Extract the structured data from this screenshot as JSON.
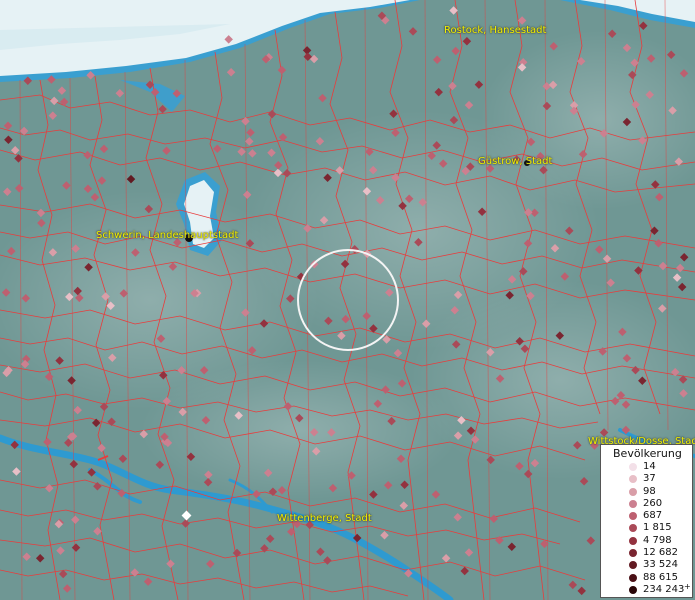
{
  "map": {
    "labels": [
      {
        "id": "rostock",
        "text": "Rostock, Hansestadt"
      },
      {
        "id": "guestrow",
        "text": "Güstrow, Stadt"
      },
      {
        "id": "schwerin",
        "text": "Schwerin, Landeshauptstadt"
      },
      {
        "id": "wittstock",
        "text": "Wittstock/Dosse, Stad"
      },
      {
        "id": "wittenberge",
        "text": "Wittenberge, Stadt"
      }
    ]
  },
  "legend": {
    "title": "Bevölkerung",
    "items": [
      {
        "label": "14",
        "color": "#f3e0e8"
      },
      {
        "label": "37",
        "color": "#e8bfc7"
      },
      {
        "label": "98",
        "color": "#d99ea8"
      },
      {
        "label": "260",
        "color": "#cc8090"
      },
      {
        "label": "687",
        "color": "#bd6070"
      },
      {
        "label": "1 815",
        "color": "#aa4a58"
      },
      {
        "label": "4 798",
        "color": "#93323f"
      },
      {
        "label": "12 682",
        "color": "#7a2530"
      },
      {
        "label": "33 524",
        "color": "#621a22"
      },
      {
        "label": "88 615",
        "color": "#4a1016"
      },
      {
        "label": "234 243",
        "color": "#2a0608",
        "plus": "+"
      }
    ]
  },
  "colors": {
    "land": "#6f9794",
    "water": "#3a9fd0",
    "boundaries": "#e83c3c",
    "city_label": "#f2f200"
  }
}
